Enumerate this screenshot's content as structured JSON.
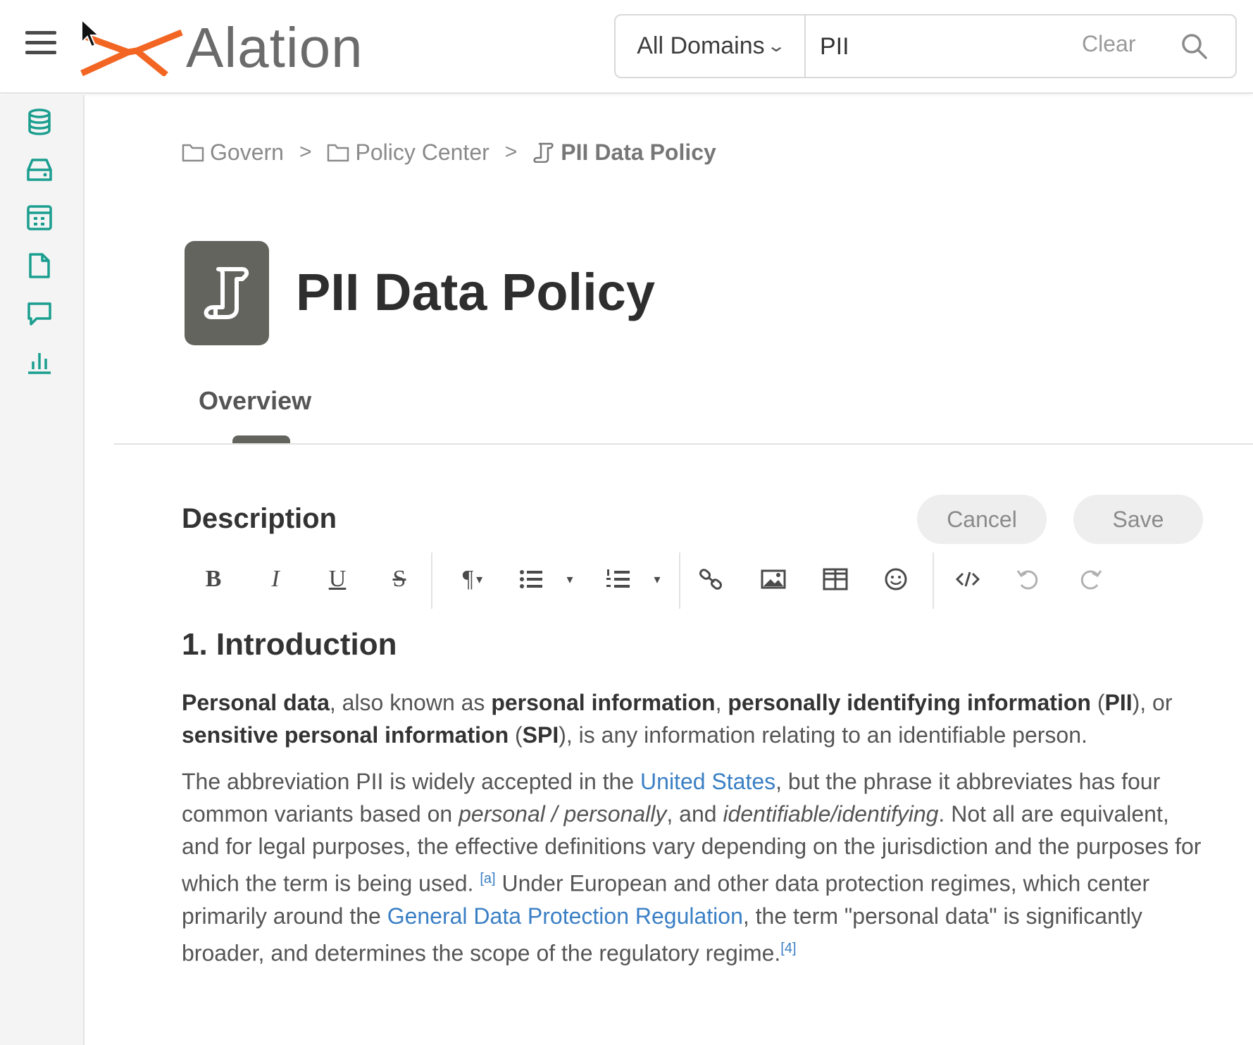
{
  "app": {
    "logo_text": "Alation",
    "brand_color": "#f26522",
    "accent_color": "#1a9e8f"
  },
  "search": {
    "domain_label": "All Domains",
    "query": "PII",
    "placeholder": "",
    "clear_label": "Clear"
  },
  "sidebar": {
    "items": [
      {
        "name": "sidebar-item-databases",
        "icon": "database-icon"
      },
      {
        "name": "sidebar-item-storage",
        "icon": "drive-icon"
      },
      {
        "name": "sidebar-item-tables",
        "icon": "table-icon"
      },
      {
        "name": "sidebar-item-articles",
        "icon": "document-icon"
      },
      {
        "name": "sidebar-item-conversations",
        "icon": "chat-icon"
      },
      {
        "name": "sidebar-item-analytics",
        "icon": "bar-chart-icon"
      }
    ]
  },
  "breadcrumb": {
    "items": [
      "Govern",
      "Policy Center",
      "PII Data Policy"
    ],
    "separator": ">"
  },
  "page": {
    "title": "PII Data Policy",
    "title_icon": "policy-scroll-icon"
  },
  "tabs": [
    {
      "label": "Overview",
      "active": true
    }
  ],
  "description": {
    "heading": "Description",
    "cancel_label": "Cancel",
    "save_label": "Save",
    "toolbar": {
      "bold": "B",
      "italic": "I",
      "underline": "U",
      "strikethrough": "S",
      "paragraph": "¶",
      "caret": "▾"
    }
  },
  "content": {
    "h1": "1. Introduction",
    "p1": {
      "b1": "Personal data",
      "t1": ", also known as ",
      "b2": "personal information",
      "t2": ", ",
      "b3": "personally identifying information",
      "t3": " (",
      "b4": "PII",
      "t4": "), or ",
      "b5": "sensitive personal information",
      "t5": " (",
      "b6": "SPI",
      "t6": "), is any information relating to an identifiable person."
    },
    "p2": {
      "t1": "The abbreviation PII is widely accepted in the ",
      "link1": "United States",
      "t2": ", but the phrase it abbreviates has four common variants based on ",
      "i1": "personal / personally",
      "t3": ", and ",
      "i2": "identifiable/identifying",
      "t4": ". Not all are equivalent, and for legal purposes, the effective definitions vary depending on the jurisdiction and the purposes for which the term is being used. ",
      "sup1": "[a]",
      "t5": " Under European and other data protection regimes, which center primarily around the ",
      "link2": "General Data Protection Regulation",
      "t6": ", the term \"personal data\" is significantly broader, and determines the scope of the regulatory regime.",
      "sup2": "[4]"
    }
  }
}
